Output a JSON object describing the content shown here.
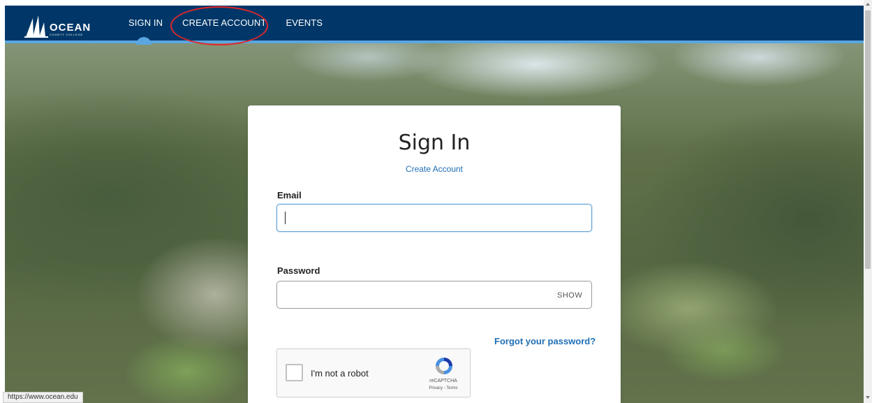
{
  "header": {
    "logo": {
      "main": "OCEAN",
      "sub": "COUNTY COLLEGE"
    },
    "nav": [
      {
        "label": "SIGN IN"
      },
      {
        "label": "CREATE ACCOUNT"
      },
      {
        "label": "EVENTS"
      }
    ],
    "active_index": 0
  },
  "form": {
    "title": "Sign In",
    "create_account_link": "Create Account",
    "email_label": "Email",
    "email_value": "",
    "password_label": "Password",
    "password_value": "",
    "show_toggle": "SHOW",
    "forgot_link": "Forgot your password?"
  },
  "recaptcha": {
    "label": "I'm not a robot",
    "brand": "reCAPTCHA",
    "terms": "Privacy - Terms"
  },
  "status_bar": {
    "url": "https://www.ocean.edu"
  },
  "colors": {
    "nav_bg": "#003768",
    "accent": "#5aa6e0",
    "link": "#1f6fb5",
    "annotation": "#e0262b"
  }
}
